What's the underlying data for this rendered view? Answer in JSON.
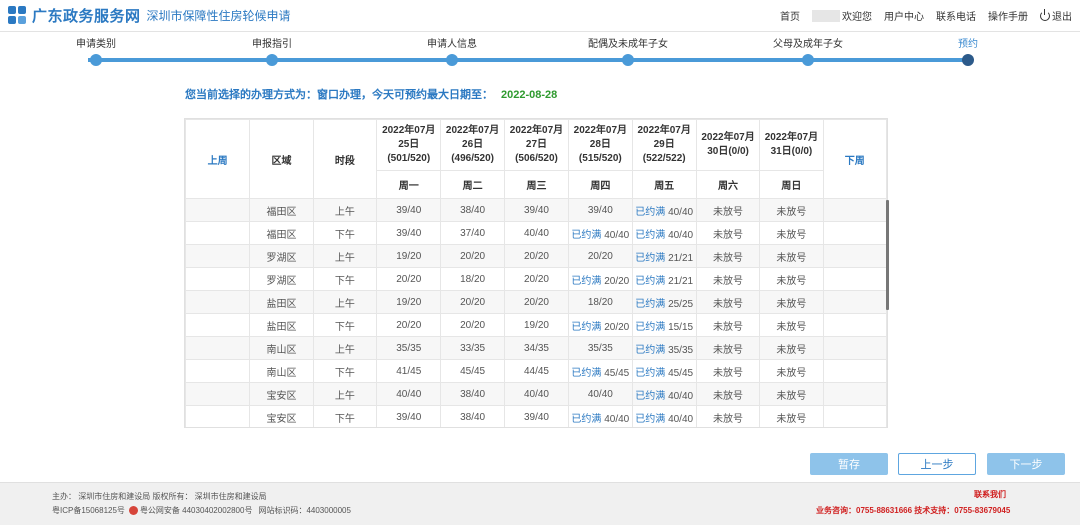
{
  "header": {
    "title": "广东政务服务网",
    "subtitle": "深圳市保障性住房轮候申请",
    "nav": {
      "home": "首页",
      "welcome": "欢迎您",
      "user_center": "用户中心",
      "contact": "联系电话",
      "manual": "操作手册",
      "logout": "退出"
    }
  },
  "steps": [
    {
      "label": "申请类别",
      "current": false
    },
    {
      "label": "申报指引",
      "current": false
    },
    {
      "label": "申请人信息",
      "current": false
    },
    {
      "label": "配偶及未成年子女",
      "current": false
    },
    {
      "label": "父母及成年子女",
      "current": false
    },
    {
      "label": "预约",
      "current": true
    }
  ],
  "notice": {
    "text": "您当前选择的办理方式为：窗口办理，今天可预约最大日期至：",
    "date": "2022-08-28"
  },
  "table": {
    "prev_week": "上周",
    "next_week": "下周",
    "col_district": "区域",
    "col_period": "时段",
    "days": [
      {
        "date_line1": "2022年07月",
        "date_line2": "25日",
        "date_line3": "(501/520)",
        "weekday": "周一"
      },
      {
        "date_line1": "2022年07月",
        "date_line2": "26日",
        "date_line3": "(496/520)",
        "weekday": "周二"
      },
      {
        "date_line1": "2022年07月",
        "date_line2": "27日",
        "date_line3": "(506/520)",
        "weekday": "周三"
      },
      {
        "date_line1": "2022年07月",
        "date_line2": "28日",
        "date_line3": "(515/520)",
        "weekday": "周四"
      },
      {
        "date_line1": "2022年07月",
        "date_line2": "29日",
        "date_line3": "(522/522)",
        "weekday": "周五"
      },
      {
        "date_line1": "2022年07月",
        "date_line2": "30日(0/0)",
        "date_line3": "",
        "weekday": "周六"
      },
      {
        "date_line1": "2022年07月",
        "date_line2": "31日(0/0)",
        "date_line3": "",
        "weekday": "周日"
      }
    ],
    "rows": [
      {
        "district": "福田区",
        "period": "上午",
        "cells": [
          {
            "t": "39/40"
          },
          {
            "t": "38/40"
          },
          {
            "t": "39/40"
          },
          {
            "t": "39/40"
          },
          {
            "full": "已约满",
            "t": "40/40"
          },
          {
            "t": "未放号"
          },
          {
            "t": "未放号"
          }
        ]
      },
      {
        "district": "福田区",
        "period": "下午",
        "cells": [
          {
            "t": "39/40"
          },
          {
            "t": "37/40"
          },
          {
            "t": "40/40"
          },
          {
            "full": "已约满",
            "t": "40/40"
          },
          {
            "full": "已约满",
            "t": "40/40"
          },
          {
            "t": "未放号"
          },
          {
            "t": "未放号"
          }
        ]
      },
      {
        "district": "罗湖区",
        "period": "上午",
        "cells": [
          {
            "t": "19/20"
          },
          {
            "t": "20/20"
          },
          {
            "t": "20/20"
          },
          {
            "t": "20/20"
          },
          {
            "full": "已约满",
            "t": "21/21"
          },
          {
            "t": "未放号"
          },
          {
            "t": "未放号"
          }
        ]
      },
      {
        "district": "罗湖区",
        "period": "下午",
        "cells": [
          {
            "t": "20/20"
          },
          {
            "t": "18/20"
          },
          {
            "t": "20/20"
          },
          {
            "full": "已约满",
            "t": "20/20"
          },
          {
            "full": "已约满",
            "t": "21/21"
          },
          {
            "t": "未放号"
          },
          {
            "t": "未放号"
          }
        ]
      },
      {
        "district": "盐田区",
        "period": "上午",
        "cells": [
          {
            "t": "19/20"
          },
          {
            "t": "20/20"
          },
          {
            "t": "20/20"
          },
          {
            "t": "18/20"
          },
          {
            "full": "已约满",
            "t": "25/25"
          },
          {
            "t": "未放号"
          },
          {
            "t": "未放号"
          }
        ]
      },
      {
        "district": "盐田区",
        "period": "下午",
        "cells": [
          {
            "t": "20/20"
          },
          {
            "t": "20/20"
          },
          {
            "t": "19/20"
          },
          {
            "full": "已约满",
            "t": "20/20"
          },
          {
            "full": "已约满",
            "t": "15/15"
          },
          {
            "t": "未放号"
          },
          {
            "t": "未放号"
          }
        ]
      },
      {
        "district": "南山区",
        "period": "上午",
        "cells": [
          {
            "t": "35/35"
          },
          {
            "t": "33/35"
          },
          {
            "t": "34/35"
          },
          {
            "t": "35/35"
          },
          {
            "full": "已约满",
            "t": "35/35"
          },
          {
            "t": "未放号"
          },
          {
            "t": "未放号"
          }
        ]
      },
      {
        "district": "南山区",
        "period": "下午",
        "cells": [
          {
            "t": "41/45"
          },
          {
            "t": "45/45"
          },
          {
            "t": "44/45"
          },
          {
            "full": "已约满",
            "t": "45/45"
          },
          {
            "full": "已约满",
            "t": "45/45"
          },
          {
            "t": "未放号"
          },
          {
            "t": "未放号"
          }
        ]
      },
      {
        "district": "宝安区",
        "period": "上午",
        "cells": [
          {
            "t": "40/40"
          },
          {
            "t": "38/40"
          },
          {
            "t": "40/40"
          },
          {
            "t": "40/40"
          },
          {
            "full": "已约满",
            "t": "40/40"
          },
          {
            "t": "未放号"
          },
          {
            "t": "未放号"
          }
        ]
      },
      {
        "district": "宝安区",
        "period": "下午",
        "cells": [
          {
            "t": "39/40"
          },
          {
            "t": "38/40"
          },
          {
            "t": "39/40"
          },
          {
            "full": "已约满",
            "t": "40/40"
          },
          {
            "full": "已约满",
            "t": "40/40"
          },
          {
            "t": "未放号"
          },
          {
            "t": "未放号"
          }
        ]
      }
    ]
  },
  "buttons": {
    "save": "暂存",
    "prev": "上一步",
    "next": "下一步"
  },
  "footer": {
    "host": "主办：  深圳市住房和建设局  版权所有：  深圳市住房和建设局",
    "icp": "粤ICP备15068125号",
    "police": "粤公网安备 44030402002800号",
    "site_code": "网站标识码：4403000005",
    "contact_us": "联系我们",
    "hotline": "业务咨询：0755-88631666 技术支持：0755-83679045"
  },
  "colors": {
    "brand": "#2b79c2",
    "date_green": "#2e9a2e",
    "footer_red": "#d02020"
  }
}
